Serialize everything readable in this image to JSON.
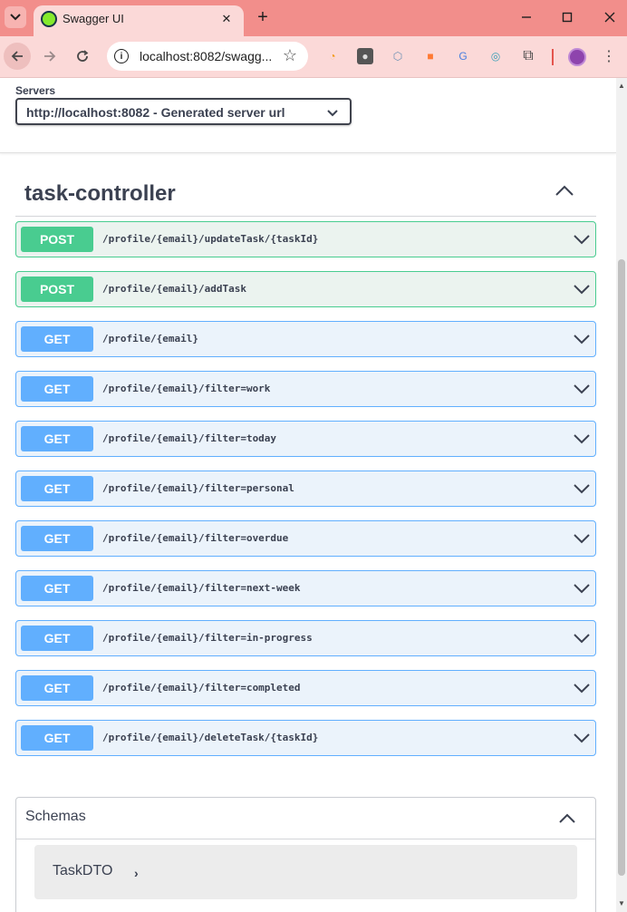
{
  "browser": {
    "tab_title": "Swagger UI",
    "url": "localhost:8082/swagg...",
    "new_tab_symbol": "+",
    "accent_color": "#f28e8b"
  },
  "servers": {
    "label": "Servers",
    "selected": "http://localhost:8082 - Generated server url"
  },
  "tag": {
    "name": "task-controller"
  },
  "operations": [
    {
      "method": "POST",
      "path": "/profile/{email}/updateTask/{taskId}"
    },
    {
      "method": "POST",
      "path": "/profile/{email}/addTask"
    },
    {
      "method": "GET",
      "path": "/profile/{email}"
    },
    {
      "method": "GET",
      "path": "/profile/{email}/filter=work"
    },
    {
      "method": "GET",
      "path": "/profile/{email}/filter=today"
    },
    {
      "method": "GET",
      "path": "/profile/{email}/filter=personal"
    },
    {
      "method": "GET",
      "path": "/profile/{email}/filter=overdue"
    },
    {
      "method": "GET",
      "path": "/profile/{email}/filter=next-week"
    },
    {
      "method": "GET",
      "path": "/profile/{email}/filter=in-progress"
    },
    {
      "method": "GET",
      "path": "/profile/{email}/filter=completed"
    },
    {
      "method": "GET",
      "path": "/profile/{email}/deleteTask/{taskId}"
    }
  ],
  "schemas": {
    "title": "Schemas",
    "models": [
      {
        "name": "TaskDTO"
      }
    ]
  },
  "colors": {
    "post": "#49cc90",
    "get": "#61affe",
    "text": "#3b4151"
  },
  "icons": [
    "tab-search-icon",
    "swagger-favicon",
    "close-icon",
    "minimize-icon",
    "maximize-icon",
    "window-close-icon",
    "back-icon",
    "forward-icon",
    "reload-icon",
    "site-info-icon",
    "bookmark-star-icon",
    "extensions-icon",
    "profile-avatar",
    "more-menu-icon",
    "chevron-down-icon",
    "chevron-up-icon",
    "chevron-right-icon"
  ]
}
